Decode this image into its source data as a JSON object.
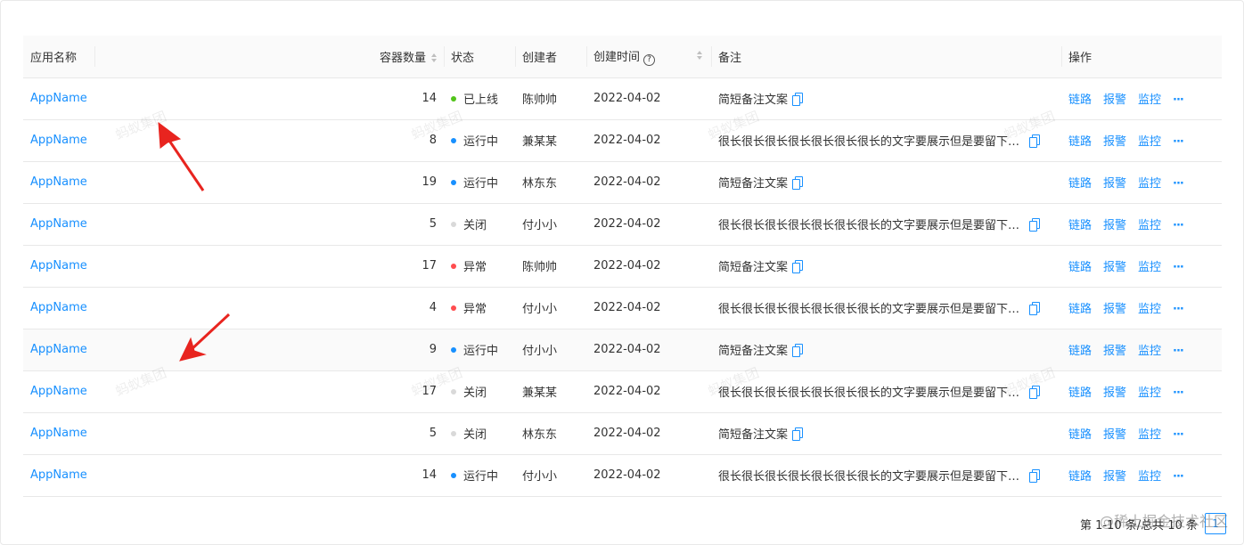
{
  "columns": [
    {
      "key": "name",
      "label": "应用名称"
    },
    {
      "key": "count",
      "label": "容器数量"
    },
    {
      "key": "status",
      "label": "状态"
    },
    {
      "key": "creator",
      "label": "创建者"
    },
    {
      "key": "created",
      "label": "创建时间"
    },
    {
      "key": "note",
      "label": "备注"
    },
    {
      "key": "ops",
      "label": "操作"
    }
  ],
  "status_colors": {
    "已上线": "#52c41a",
    "运行中": "#1890ff",
    "关闭": "#d9d9d9",
    "异常": "#ff4d4f"
  },
  "actions": {
    "trace": "链路",
    "alarm": "报警",
    "monitor": "监控",
    "more": "···"
  },
  "rows": [
    {
      "name": "AppName",
      "count": "14",
      "status": "已上线",
      "creator": "陈帅帅",
      "created": "2022-04-02",
      "note": "简短备注文案"
    },
    {
      "name": "AppName",
      "count": "8",
      "status": "运行中",
      "creator": "兼某某",
      "created": "2022-04-02",
      "note": "很长很长很长很长很长很长很长的文字要展示但是要留下尾巴"
    },
    {
      "name": "AppName",
      "count": "19",
      "status": "运行中",
      "creator": "林东东",
      "created": "2022-04-02",
      "note": "简短备注文案"
    },
    {
      "name": "AppName",
      "count": "5",
      "status": "关闭",
      "creator": "付小小",
      "created": "2022-04-02",
      "note": "很长很长很长很长很长很长很长的文字要展示但是要留下尾巴"
    },
    {
      "name": "AppName",
      "count": "17",
      "status": "异常",
      "creator": "陈帅帅",
      "created": "2022-04-02",
      "note": "简短备注文案"
    },
    {
      "name": "AppName",
      "count": "4",
      "status": "异常",
      "creator": "付小小",
      "created": "2022-04-02",
      "note": "很长很长很长很长很长很长很长的文字要展示但是要留下尾巴"
    },
    {
      "name": "AppName",
      "count": "9",
      "status": "运行中",
      "creator": "付小小",
      "created": "2022-04-02",
      "note": "简短备注文案"
    },
    {
      "name": "AppName",
      "count": "17",
      "status": "关闭",
      "creator": "兼某某",
      "created": "2022-04-02",
      "note": "很长很长很长很长很长很长很长的文字要展示但是要留下尾巴"
    },
    {
      "name": "AppName",
      "count": "5",
      "status": "关闭",
      "creator": "林东东",
      "created": "2022-04-02",
      "note": "简短备注文案"
    },
    {
      "name": "AppName",
      "count": "14",
      "status": "运行中",
      "creator": "付小小",
      "created": "2022-04-02",
      "note": "很长很长很长很长很长很长很长的文字要展示但是要留下尾巴"
    }
  ],
  "pagination": {
    "summary": "第 1-10 条/总共 10 条",
    "current_page": "1"
  },
  "watermark_text": "蚂蚁集团",
  "site_watermark": "@稀土掘金技术社区"
}
